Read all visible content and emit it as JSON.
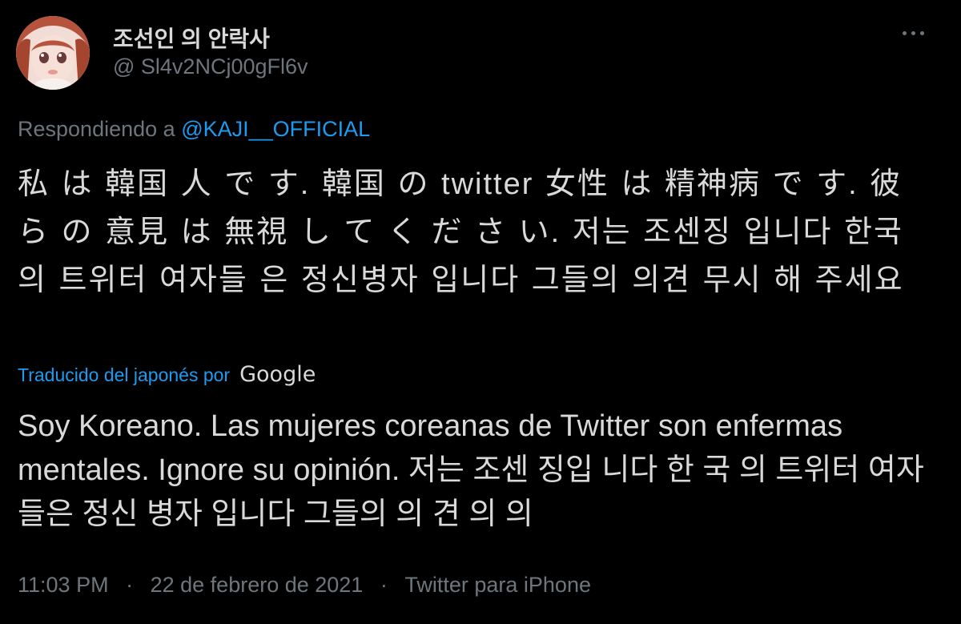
{
  "author": {
    "display_name": "조선인 의 안락사",
    "handle": "@ Sl4v2NCj00gFl6v"
  },
  "reply": {
    "prefix": "Respondiendo a",
    "mention": "@KAJI__OFFICIAL"
  },
  "tweet": {
    "text": "私 は 韓国 人 で す. 韓国 の twitter 女性 は 精神病 で す. 彼 ら の 意見 は 無視 し て く だ さ い. 저는 조센징 입니다 한국 의 트위터 여자들 은 정신병자 입니다 그들의 의견 무시 해 주세요"
  },
  "translation": {
    "label": "Traducido del japonés por",
    "provider": "Google",
    "text": "Soy Koreano. Las mujeres coreanas de Twitter son enfermas mentales. Ignore su opinión. 저는 조센 징입 니다 한 국 의 트위터 여자 들은 정신 병자 입니다 그들의 의 견 의 의"
  },
  "meta": {
    "time": "11:03 PM",
    "separator1": "·",
    "date": "22 de febrero de 2021",
    "separator2": "·",
    "source": "Twitter para iPhone"
  },
  "icons": {
    "more": "more-horizontal-icon",
    "avatar": "anime-avatar"
  },
  "colors": {
    "background": "#000000",
    "text": "#d9d9d9",
    "secondary": "#6e767d",
    "accent": "#1d9bf0"
  }
}
